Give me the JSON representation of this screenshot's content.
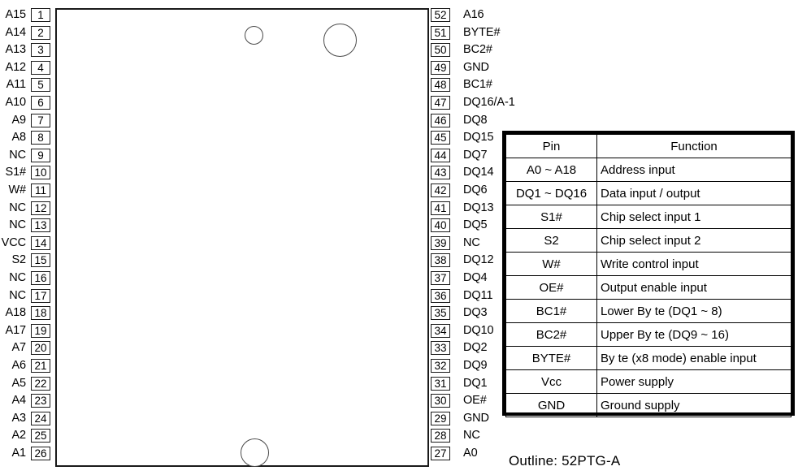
{
  "package": {
    "outline_caption": "Outline: 52PTG-A",
    "body_name": "chip-package-body",
    "marks": [
      {
        "name": "pkg-circle-small",
        "shape": "circle"
      },
      {
        "name": "pkg-circle-large",
        "shape": "circle"
      },
      {
        "name": "pkg-circle-bottom",
        "shape": "circle"
      }
    ]
  },
  "pins": {
    "left": [
      {
        "num": "1",
        "label": "A15"
      },
      {
        "num": "2",
        "label": "A14"
      },
      {
        "num": "3",
        "label": "A13"
      },
      {
        "num": "4",
        "label": "A12"
      },
      {
        "num": "5",
        "label": "A11"
      },
      {
        "num": "6",
        "label": "A10"
      },
      {
        "num": "7",
        "label": "A9"
      },
      {
        "num": "8",
        "label": "A8"
      },
      {
        "num": "9",
        "label": "NC"
      },
      {
        "num": "10",
        "label": "S1#"
      },
      {
        "num": "11",
        "label": "W#"
      },
      {
        "num": "12",
        "label": "NC"
      },
      {
        "num": "13",
        "label": "NC"
      },
      {
        "num": "14",
        "label": "VCC"
      },
      {
        "num": "15",
        "label": "S2"
      },
      {
        "num": "16",
        "label": "NC"
      },
      {
        "num": "17",
        "label": "NC"
      },
      {
        "num": "18",
        "label": "A18"
      },
      {
        "num": "19",
        "label": "A17"
      },
      {
        "num": "20",
        "label": "A7"
      },
      {
        "num": "21",
        "label": "A6"
      },
      {
        "num": "22",
        "label": "A5"
      },
      {
        "num": "23",
        "label": "A4"
      },
      {
        "num": "24",
        "label": "A3"
      },
      {
        "num": "25",
        "label": "A2"
      },
      {
        "num": "26",
        "label": "A1"
      }
    ],
    "right": [
      {
        "num": "52",
        "label": "A16"
      },
      {
        "num": "51",
        "label": "BYTE#"
      },
      {
        "num": "50",
        "label": "BC2#"
      },
      {
        "num": "49",
        "label": "GND"
      },
      {
        "num": "48",
        "label": "BC1#"
      },
      {
        "num": "47",
        "label": "DQ16/A-1"
      },
      {
        "num": "46",
        "label": "DQ8"
      },
      {
        "num": "45",
        "label": "DQ15"
      },
      {
        "num": "44",
        "label": "DQ7"
      },
      {
        "num": "43",
        "label": "DQ14"
      },
      {
        "num": "42",
        "label": "DQ6"
      },
      {
        "num": "41",
        "label": "DQ13"
      },
      {
        "num": "40",
        "label": "DQ5"
      },
      {
        "num": "39",
        "label": "NC"
      },
      {
        "num": "38",
        "label": "DQ12"
      },
      {
        "num": "37",
        "label": "DQ4"
      },
      {
        "num": "36",
        "label": "DQ11"
      },
      {
        "num": "35",
        "label": "DQ3"
      },
      {
        "num": "34",
        "label": "DQ10"
      },
      {
        "num": "33",
        "label": "DQ2"
      },
      {
        "num": "32",
        "label": "DQ9"
      },
      {
        "num": "31",
        "label": "DQ1"
      },
      {
        "num": "30",
        "label": "OE#"
      },
      {
        "num": "29",
        "label": "GND"
      },
      {
        "num": "28",
        "label": "NC"
      },
      {
        "num": "27",
        "label": "A0"
      }
    ]
  },
  "function_table": {
    "headers": {
      "pin": "Pin",
      "function": "Function"
    },
    "rows": [
      {
        "pin": "A0 ~ A18",
        "function": "Address input"
      },
      {
        "pin": "DQ1 ~ DQ16",
        "function": "Data input / output"
      },
      {
        "pin": "S1#",
        "function": "Chip select input 1"
      },
      {
        "pin": "S2",
        "function": "Chip select input 2"
      },
      {
        "pin": "W#",
        "function": "Write control input"
      },
      {
        "pin": "OE#",
        "function": "Output enable input"
      },
      {
        "pin": "BC1#",
        "function": "Lower  By te (DQ1 ~ 8)"
      },
      {
        "pin": "BC2#",
        "function": "Upper  By te (DQ9 ~ 16)"
      },
      {
        "pin": "BYTE#",
        "function": "By te (x8 mode) enable input"
      },
      {
        "pin": "Vcc",
        "function": "Power supply"
      },
      {
        "pin": "GND",
        "function": "Ground supply"
      }
    ]
  },
  "colors": {
    "ink": "#000000",
    "outline": "#1a1a1a",
    "circle_stroke": "#4a4a4a",
    "background": "#ffffff"
  }
}
